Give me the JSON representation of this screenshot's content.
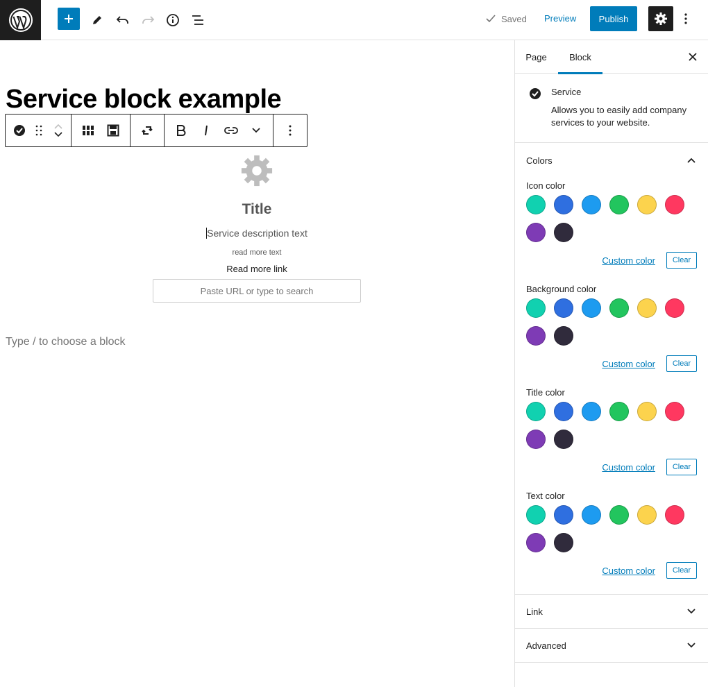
{
  "header": {
    "saved_label": "Saved",
    "preview_label": "Preview",
    "publish_label": "Publish",
    "colors": {
      "accent": "#007cba",
      "dark": "#1e1e1e"
    }
  },
  "editor": {
    "title": "Service block example",
    "service": {
      "title": "Title",
      "description": "Service description text",
      "read_more_text": "read more text",
      "read_more_link": "Read more link",
      "url_placeholder": "Paste URL or type to search"
    },
    "appender": "Type / to choose a block"
  },
  "sidebar": {
    "tabs": [
      "Page",
      "Block"
    ],
    "active_tab": "Block",
    "block": {
      "name": "Service",
      "description": "Allows you to easily add company services to your website."
    },
    "colors_panel": {
      "title": "Colors",
      "custom_color_label": "Custom color",
      "clear_label": "Clear",
      "palette": [
        "#11d1b0",
        "#2f6fe0",
        "#1d9bf0",
        "#22c55e",
        "#fcd34d",
        "#ff3860",
        "#7e3bb5",
        "#302b3c"
      ],
      "groups": [
        "Icon color",
        "Background color",
        "Title color",
        "Text color"
      ]
    },
    "link_panel": {
      "title": "Link"
    },
    "advanced_panel": {
      "title": "Advanced"
    }
  }
}
